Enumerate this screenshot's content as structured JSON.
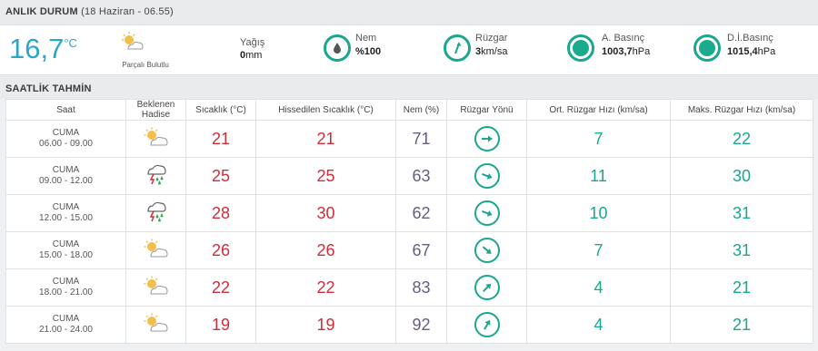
{
  "current": {
    "title": "ANLIK DURUM",
    "datetime": "(18 Haziran - 06.55)",
    "temperature": "16,7",
    "unit": "°C",
    "condition": "Parçalı Bulutlu",
    "rain_label": "Yağış",
    "rain_value": "0",
    "rain_unit": "mm",
    "humidity_label": "Nem",
    "humidity_value": "%100",
    "wind_label": "Rüzgar",
    "wind_value": "3",
    "wind_unit": "km/sa",
    "pressure_label": "A. Basınç",
    "pressure_value": "1003,7",
    "pressure_unit": "hPa",
    "sea_pressure_label": "D.İ.Basınç",
    "sea_pressure_value": "1015,4",
    "sea_pressure_unit": "hPa"
  },
  "hourly": {
    "title": "SAATLİK TAHMİN",
    "headers": {
      "time": "Saat",
      "forecast": "Beklenen Hadise",
      "temp": "Sıcaklık (°C)",
      "feels": "Hissedilen Sıcaklık (°C)",
      "humidity": "Nem (%)",
      "wind_dir": "Rüzgar Yönü",
      "avg_wind": "Ort. Rüzgar Hızı (km/sa)",
      "max_wind": "Maks. Rüzgar Hızı (km/sa)"
    },
    "rows": [
      {
        "day": "CUMA",
        "range": "06.00 - 09.00",
        "icon": "partly-cloudy-icon",
        "temp": "21",
        "feels": "21",
        "humidity": "71",
        "wind_deg": 90,
        "avg": "7",
        "max": "22"
      },
      {
        "day": "CUMA",
        "range": "09.00 - 12.00",
        "icon": "thunderstorm-icon",
        "temp": "25",
        "feels": "25",
        "humidity": "63",
        "wind_deg": 110,
        "avg": "11",
        "max": "30"
      },
      {
        "day": "CUMA",
        "range": "12.00 - 15.00",
        "icon": "thunderstorm-icon",
        "temp": "28",
        "feels": "30",
        "humidity": "62",
        "wind_deg": 110,
        "avg": "10",
        "max": "31"
      },
      {
        "day": "CUMA",
        "range": "15.00 - 18.00",
        "icon": "partly-cloudy-icon",
        "temp": "26",
        "feels": "26",
        "humidity": "67",
        "wind_deg": 130,
        "avg": "7",
        "max": "31"
      },
      {
        "day": "CUMA",
        "range": "18.00 - 21.00",
        "icon": "partly-cloudy-icon",
        "temp": "22",
        "feels": "22",
        "humidity": "83",
        "wind_deg": 45,
        "avg": "4",
        "max": "21"
      },
      {
        "day": "CUMA",
        "range": "21.00 - 24.00",
        "icon": "partly-cloudy-icon",
        "temp": "19",
        "feels": "19",
        "humidity": "92",
        "wind_deg": 30,
        "avg": "4",
        "max": "21"
      }
    ]
  },
  "colors": {
    "accent": "#1aa68f",
    "temp": "#2aa6c9",
    "red": "#cc2e3b",
    "purple": "#6a5b84"
  }
}
